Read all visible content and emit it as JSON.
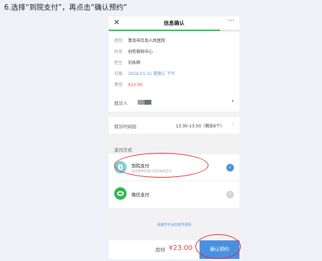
{
  "caption": "6.选择“到院支付”，再点击“确认预约”",
  "header": {
    "title": "信息确认",
    "close_icon": "close-icon",
    "more_icon": "more-icon"
  },
  "progress_fraction": 0.85,
  "info": [
    {
      "label": "医院",
      "value": "青岛市红岛人民医院"
    },
    {
      "label": "科室",
      "value": "创伤骨科中心"
    },
    {
      "label": "医生",
      "value": "刘永辉"
    },
    {
      "label": "日期",
      "value": "2024-01-31 星期三 下午"
    },
    {
      "label": "费用",
      "value": "¥23.00"
    }
  ],
  "patient": {
    "label": "就诊人"
  },
  "slot": {
    "label": "就诊时间段",
    "value": "13:30-13:50（剩余6个）"
  },
  "payment": {
    "title": "支付方式",
    "options": [
      {
        "name": "到院支付",
        "desc": "挂号费用在窗口或自助机支付",
        "selected": true,
        "icon": "hospital-pay-icon"
      },
      {
        "name": "微信支付",
        "desc": "",
        "selected": false,
        "icon": "wechat-pay-icon"
      }
    ]
  },
  "notice": "请遵守平台的挂号规则",
  "footer": {
    "due_label": "应付",
    "due_amount": "¥23.00",
    "confirm_label": "确认预约"
  },
  "colors": {
    "accent": "#4a90e2",
    "price": "#e64545",
    "progress": "#2fbf4e",
    "annotation": "#e0252a"
  }
}
